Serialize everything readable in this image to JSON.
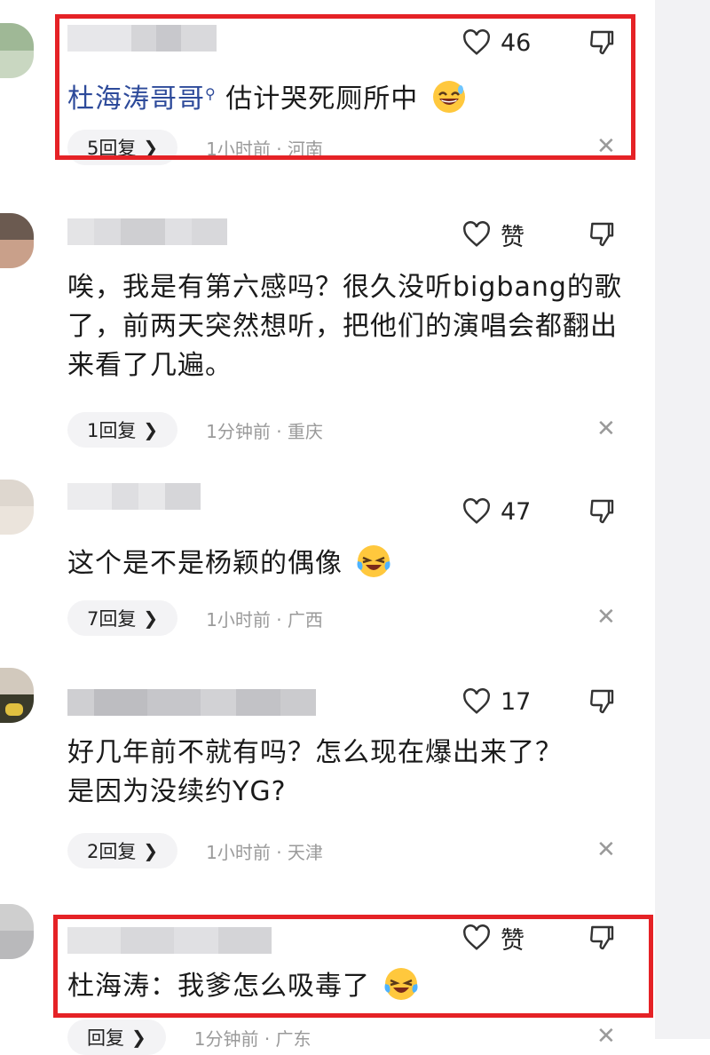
{
  "comments": [
    {
      "likes": "46",
      "mention": "杜海涛哥哥",
      "text": "估计哭死厕所中",
      "emoji": "grinning-sweat-emoji",
      "replies": "5回复",
      "time": "1小时前 · 河南"
    },
    {
      "likes": "赞",
      "text": "唉，我是有第六感吗？很久没听bigbang的歌了，前两天突然想听，把他们的演唱会都翻出来看了几遍。",
      "replies": "1回复",
      "time": "1分钟前 · 重庆"
    },
    {
      "likes": "47",
      "text": "这个是不是杨颖的偶像",
      "emoji": "laughing-crying-emoji",
      "replies": "7回复",
      "time": "1小时前 · 广西"
    },
    {
      "likes": "17",
      "text": "好几年前不就有吗？怎么现在爆出来了？是因为没续约YG?",
      "replies": "2回复",
      "time": "1小时前 · 天津"
    },
    {
      "likes": "赞",
      "text": "杜海涛：我爹怎么吸毒了",
      "emoji": "laughing-crying-emoji",
      "replies": "回复",
      "time": "1分钟前 · 广东"
    }
  ],
  "icons": {
    "like": "heart-outline-icon",
    "dislike": "thumbs-down-icon",
    "close": "close-icon",
    "chevron": "chevron-right-icon"
  },
  "colors": {
    "highlight": "#e52226",
    "mention": "#2d4a9a",
    "meta": "#9a9a9a"
  }
}
